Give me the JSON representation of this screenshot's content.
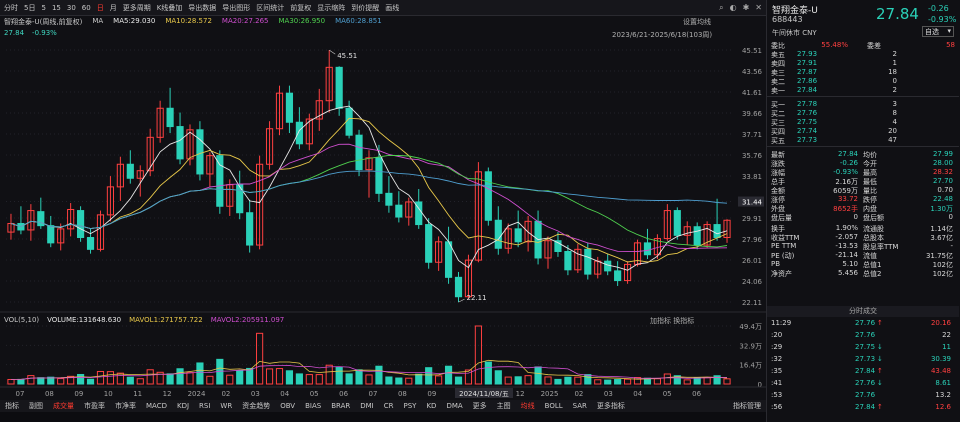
{
  "toolbar": {
    "items": [
      "分时",
      "5日",
      "5",
      "15",
      "30",
      "60",
      "日",
      "月",
      "更多周期",
      "K线叠加",
      "导出数据",
      "导出图形",
      "区间统计",
      "前复权",
      "显示缩阵",
      "到价提醒",
      "画线"
    ],
    "active_index": 6
  },
  "chart": {
    "title": "智翔金泰-U(周线,前复权)",
    "ma_label": "MA",
    "ma5": "MA5:29.030",
    "ma10": "MA10:28.572",
    "ma20": "MA20:27.265",
    "ma30": "MA30:26.950",
    "ma60": "MA60:28.851",
    "sub_price": "27.84",
    "sub_pct": "-0.93%",
    "setting": "设置均线",
    "range": "2023/6/21-2025/6/18(103周)",
    "high_label": "45.51",
    "low_label": "22.11",
    "y_ticks": [
      "45.51",
      "43.56",
      "41.61",
      "39.66",
      "37.71",
      "35.76",
      "33.81",
      "31.44",
      "29.91",
      "27.96",
      "26.01",
      "24.06",
      "22.11"
    ],
    "x_ticks": [
      "07",
      "08",
      "09",
      "10",
      "11",
      "12",
      "2024",
      "02",
      "03",
      "04",
      "05",
      "06",
      "07",
      "08",
      "09",
      "10",
      "11",
      "12",
      "2025",
      "02",
      "03",
      "04",
      "05",
      "06"
    ],
    "cursor_date": "2024/11/08/五",
    "price_tag": "31.44"
  },
  "colors": {
    "up": "#ff4040",
    "down": "#2ad1b8",
    "ma5": "#e8e8e8",
    "ma10": "#e8c84a",
    "ma20": "#d04fd0",
    "ma30": "#4fd04f",
    "ma60": "#4f9fd0",
    "accent": "#ff3b30"
  },
  "volume": {
    "label": "VOL(5,10)",
    "vol": "VOLUME:131648.630",
    "mavol1": "MAVOL1:271757.722",
    "mavol2": "MAVOL2:205911.097",
    "right": "加指标 换指标",
    "y_ticks": [
      "49.4万",
      "32.9万",
      "16.4万",
      "0"
    ]
  },
  "indicator_bar": {
    "items": [
      "指标",
      "副图",
      "成交量",
      "市盈率",
      "市净率",
      "MACD",
      "KDJ",
      "RSI",
      "WR",
      "资金趋势",
      "OBV",
      "BIAS",
      "BRAR",
      "DMI",
      "CR",
      "PSY",
      "KD",
      "DMA",
      "更多",
      "主图",
      "均线",
      "BOLL",
      "SAR",
      "更多指标"
    ],
    "active": [
      2,
      20
    ],
    "right": "指标管理"
  },
  "quote": {
    "name": "智翔金泰-U",
    "code": "688443",
    "price": "27.84",
    "change": "-0.26",
    "pct": "-0.93%",
    "sub": "午间休市 CNY",
    "select": "自选",
    "webi": {
      "label": "委比",
      "value": "55.48%",
      "diff_label": "委差",
      "diff": "58"
    },
    "asks": [
      {
        "label": "卖五",
        "price": "27.93",
        "vol": "2"
      },
      {
        "label": "卖四",
        "price": "27.91",
        "vol": "1"
      },
      {
        "label": "卖三",
        "price": "27.87",
        "vol": "18"
      },
      {
        "label": "卖二",
        "price": "27.86",
        "vol": "0"
      },
      {
        "label": "卖一",
        "price": "27.84",
        "vol": "2"
      }
    ],
    "bids": [
      {
        "label": "买一",
        "price": "27.78",
        "vol": "3"
      },
      {
        "label": "买二",
        "price": "27.76",
        "vol": "8"
      },
      {
        "label": "买三",
        "price": "27.75",
        "vol": "4"
      },
      {
        "label": "买四",
        "price": "27.74",
        "vol": "20"
      },
      {
        "label": "买五",
        "price": "27.73",
        "vol": "47"
      }
    ],
    "stats": [
      {
        "l1": "最新",
        "v1": "27.84",
        "c1": "dn",
        "l2": "均价",
        "v2": "27.99",
        "c2": "dn"
      },
      {
        "l1": "涨跌",
        "v1": "-0.26",
        "c1": "dn",
        "l2": "今开",
        "v2": "28.00",
        "c2": "dn"
      },
      {
        "l1": "涨幅",
        "v1": "-0.93%",
        "c1": "dn",
        "l2": "最高",
        "v2": "28.32",
        "c2": "up"
      },
      {
        "l1": "总手",
        "v1": "2.16万",
        "c1": "wh",
        "l2": "最低",
        "v2": "27.70",
        "c2": "dn"
      },
      {
        "l1": "金额",
        "v1": "6059万",
        "c1": "wh",
        "l2": "量比",
        "v2": "0.70",
        "c2": "wh"
      },
      {
        "l1": "涨停",
        "v1": "33.72",
        "c1": "up",
        "l2": "跌停",
        "v2": "22.48",
        "c2": "dn"
      },
      {
        "l1": "外盘",
        "v1": "8652手",
        "c1": "up",
        "l2": "内盘",
        "v2": "1.30万",
        "c2": "dn"
      },
      {
        "l1": "盘后量",
        "v1": "0",
        "c1": "wh",
        "l2": "盘后额",
        "v2": "0",
        "c2": "wh"
      },
      {
        "l1": "换手",
        "v1": "1.90%",
        "c1": "wh",
        "l2": "流通股",
        "v2": "1.14亿",
        "c2": "wh"
      },
      {
        "l1": "收益TTM",
        "v1": "-2.057",
        "c1": "wh",
        "l2": "总股本",
        "v2": "3.67亿",
        "c2": "wh"
      },
      {
        "l1": "PE TTM",
        "v1": "-13.53",
        "c1": "wh",
        "l2": "股息率TTM",
        "v2": "-",
        "c2": "wh"
      },
      {
        "l1": "PE (动)",
        "v1": "-21.14",
        "c1": "wh",
        "l2": "流值",
        "v2": "31.75亿",
        "c2": "wh"
      },
      {
        "l1": "PB",
        "v1": "5.10",
        "c1": "wh",
        "l2": "总值1",
        "v2": "102亿",
        "c2": "wh"
      },
      {
        "l1": "净资产",
        "v1": "5.456",
        "c1": "wh",
        "l2": "总值2",
        "v2": "102亿",
        "c2": "wh"
      }
    ],
    "trades_title": "分时成交",
    "trades": [
      {
        "time": "11:29",
        "price": "27.76",
        "arrow": "↑",
        "dir": "up",
        "vol": "20.16"
      },
      {
        "time": ":20",
        "price": "27.76",
        "arrow": "",
        "dir": "wh",
        "vol": "22"
      },
      {
        "time": ":29",
        "price": "27.75",
        "arrow": "↓",
        "dir": "dn",
        "vol": "11"
      },
      {
        "time": ":32",
        "price": "27.73",
        "arrow": "↓",
        "dir": "dn",
        "vol": "30.39"
      },
      {
        "time": ":35",
        "price": "27.84",
        "arrow": "↑",
        "dir": "up",
        "vol": "43.48"
      },
      {
        "time": ":41",
        "price": "27.76",
        "arrow": "↓",
        "dir": "dn",
        "vol": "8.61"
      },
      {
        "time": ":53",
        "price": "27.76",
        "arrow": "",
        "dir": "wh",
        "vol": "13.2"
      },
      {
        "time": ":56",
        "price": "27.84",
        "arrow": "↑",
        "dir": "up",
        "vol": "12.6"
      }
    ]
  },
  "chart_data": {
    "type": "candlestick",
    "ylim": [
      22.11,
      45.51
    ],
    "candles": [
      [
        28.6,
        30.3,
        27.9,
        29.4
      ],
      [
        29.4,
        31.0,
        28.4,
        28.8
      ],
      [
        28.8,
        31.2,
        27.8,
        30.6
      ],
      [
        30.5,
        31.8,
        28.9,
        29.2
      ],
      [
        29.2,
        30.1,
        27.2,
        27.6
      ],
      [
        27.6,
        29.4,
        26.9,
        28.9
      ],
      [
        28.9,
        31.3,
        28.2,
        30.7
      ],
      [
        30.6,
        31.0,
        27.7,
        28.1
      ],
      [
        28.1,
        28.9,
        26.6,
        27.0
      ],
      [
        27.0,
        30.6,
        26.8,
        30.2
      ],
      [
        30.2,
        33.8,
        29.6,
        32.8
      ],
      [
        32.8,
        35.6,
        31.5,
        34.9
      ],
      [
        34.9,
        36.2,
        33.1,
        33.6
      ],
      [
        33.6,
        34.8,
        31.9,
        34.3
      ],
      [
        34.3,
        38.2,
        33.8,
        37.4
      ],
      [
        37.4,
        40.8,
        36.9,
        40.1
      ],
      [
        40.1,
        42.0,
        37.8,
        38.4
      ],
      [
        38.4,
        39.7,
        34.9,
        35.4
      ],
      [
        35.4,
        38.6,
        34.8,
        38.1
      ],
      [
        38.1,
        38.9,
        33.4,
        34.0
      ],
      [
        34.0,
        36.0,
        32.8,
        35.7
      ],
      [
        35.7,
        36.2,
        30.3,
        31.0
      ],
      [
        31.0,
        33.5,
        30.1,
        33.0
      ],
      [
        33.0,
        34.3,
        29.8,
        30.4
      ],
      [
        30.4,
        31.6,
        26.7,
        27.4
      ],
      [
        27.4,
        35.7,
        27.0,
        34.9
      ],
      [
        34.9,
        38.9,
        34.4,
        38.2
      ],
      [
        38.2,
        42.2,
        37.6,
        41.5
      ],
      [
        41.5,
        42.2,
        37.8,
        38.8
      ],
      [
        38.8,
        40.2,
        36.3,
        36.8
      ],
      [
        36.8,
        39.6,
        36.2,
        39.1
      ],
      [
        39.1,
        41.9,
        38.0,
        40.8
      ],
      [
        40.8,
        45.5,
        39.7,
        43.9
      ],
      [
        43.9,
        44.0,
        39.4,
        40.1
      ],
      [
        40.1,
        40.8,
        37.3,
        37.6
      ],
      [
        37.6,
        38.1,
        33.8,
        34.4
      ],
      [
        34.4,
        36.2,
        31.8,
        35.5
      ],
      [
        35.5,
        36.7,
        31.4,
        32.2
      ],
      [
        32.2,
        33.8,
        30.4,
        31.1
      ],
      [
        31.1,
        32.4,
        29.5,
        30.0
      ],
      [
        30.0,
        31.8,
        29.2,
        31.4
      ],
      [
        31.4,
        32.6,
        28.9,
        29.3
      ],
      [
        29.3,
        29.9,
        25.2,
        25.8
      ],
      [
        25.8,
        28.2,
        25.0,
        27.7
      ],
      [
        27.7,
        29.1,
        23.8,
        24.4
      ],
      [
        24.4,
        24.9,
        22.1,
        22.6
      ],
      [
        22.6,
        26.5,
        22.4,
        26.0
      ],
      [
        26.0,
        35.1,
        25.8,
        34.2
      ],
      [
        34.2,
        34.6,
        29.2,
        29.7
      ],
      [
        29.7,
        31.0,
        26.5,
        27.1
      ],
      [
        27.1,
        29.4,
        26.6,
        28.9
      ],
      [
        28.9,
        30.6,
        27.2,
        27.7
      ],
      [
        27.7,
        30.1,
        26.8,
        29.6
      ],
      [
        29.6,
        30.6,
        25.6,
        26.2
      ],
      [
        26.2,
        28.2,
        25.2,
        27.8
      ],
      [
        27.8,
        28.6,
        26.3,
        26.8
      ],
      [
        26.8,
        27.4,
        24.6,
        25.1
      ],
      [
        25.1,
        27.5,
        24.8,
        27.0
      ],
      [
        27.0,
        27.6,
        24.2,
        24.7
      ],
      [
        24.7,
        26.3,
        24.3,
        25.9
      ],
      [
        25.9,
        26.6,
        24.6,
        25.0
      ],
      [
        25.0,
        25.9,
        23.6,
        24.1
      ],
      [
        24.1,
        25.9,
        23.8,
        25.6
      ],
      [
        25.6,
        27.9,
        25.4,
        27.6
      ],
      [
        27.6,
        28.9,
        26.1,
        26.5
      ],
      [
        26.5,
        28.4,
        26.1,
        28.0
      ],
      [
        28.0,
        31.2,
        27.8,
        30.6
      ],
      [
        30.6,
        30.9,
        27.9,
        28.3
      ],
      [
        28.3,
        29.6,
        27.4,
        29.1
      ],
      [
        29.1,
        29.5,
        27.0,
        27.4
      ],
      [
        27.4,
        29.6,
        27.1,
        29.3
      ],
      [
        29.3,
        31.7,
        27.8,
        28.1
      ],
      [
        28.1,
        29.8,
        27.6,
        29.7
      ]
    ],
    "volume_max": "49.4万"
  }
}
